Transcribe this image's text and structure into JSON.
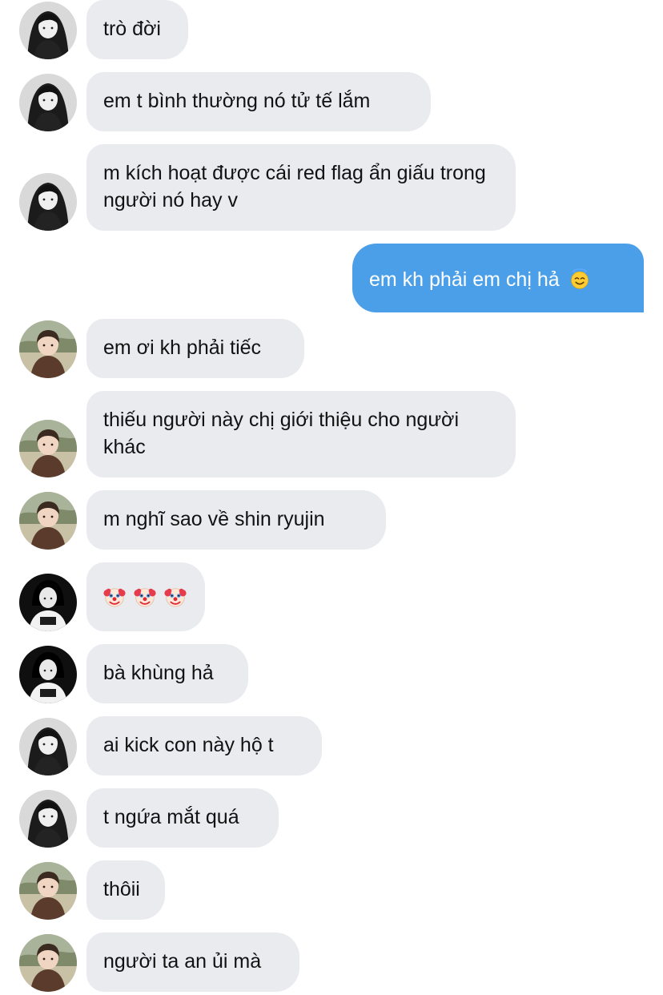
{
  "conversation": {
    "messages": [
      {
        "sender": "girl-bw-hair",
        "direction": "incoming",
        "text": "trò đời"
      },
      {
        "sender": "girl-bw-hair",
        "direction": "incoming",
        "text": "em t bình thường nó tử tế lắm"
      },
      {
        "sender": "girl-bw-hair",
        "direction": "incoming",
        "text": "m kích hoạt được cái red flag ẩn giấu trong người nó hay v"
      },
      {
        "sender": "me",
        "direction": "outgoing",
        "text": "em kh phải em chị hả",
        "emoji": "smiling-face-with-halo"
      },
      {
        "sender": "child-brown",
        "direction": "incoming",
        "text": "em ơi kh phải tiếc"
      },
      {
        "sender": "child-brown",
        "direction": "incoming",
        "text": "thiếu người này chị giới thiệu cho người khác"
      },
      {
        "sender": "child-brown",
        "direction": "incoming",
        "text": "m nghĩ sao về shin ryujin"
      },
      {
        "sender": "girl-bw-shirt",
        "direction": "incoming",
        "emojis": [
          "clown-face",
          "clown-face",
          "clown-face"
        ]
      },
      {
        "sender": "girl-bw-shirt",
        "direction": "incoming",
        "text": "bà khùng hả"
      },
      {
        "sender": "girl-bw-hair",
        "direction": "incoming",
        "text": "ai kick con này hộ t"
      },
      {
        "sender": "girl-bw-hair",
        "direction": "incoming",
        "text": "t ngứa mắt quá"
      },
      {
        "sender": "child-brown",
        "direction": "incoming",
        "text": "thôii"
      },
      {
        "sender": "child-brown",
        "direction": "incoming",
        "text": "người ta an ủi mà"
      }
    ]
  },
  "colors": {
    "incoming_bubble": "#e9ebef",
    "outgoing_bubble": "#4a9fe8",
    "incoming_text": "#121212",
    "outgoing_text": "#ffffff"
  }
}
